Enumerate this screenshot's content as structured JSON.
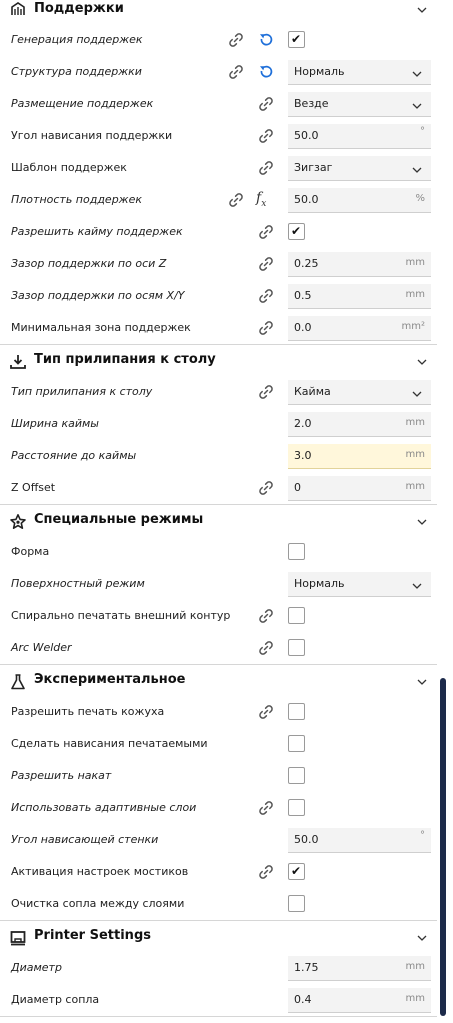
{
  "sections": [
    {
      "title": "Поддержки",
      "icon": "support-icon",
      "rows": [
        {
          "label": "Генерация поддержек",
          "italic": true,
          "link": "left",
          "reset": true,
          "control": "checkbox",
          "checked": true
        },
        {
          "label": "Структура поддержки",
          "italic": true,
          "link": "left",
          "reset": true,
          "control": "select",
          "value": "Нормаль"
        },
        {
          "label": "Размещение поддержек",
          "italic": true,
          "link": "right",
          "control": "select",
          "value": "Везде"
        },
        {
          "label": "Угол нависания поддержки",
          "italic": false,
          "link": "right",
          "control": "field",
          "value": "50.0",
          "unit": "°"
        },
        {
          "label": "Шаблон поддержек",
          "italic": false,
          "link": "right",
          "control": "select",
          "value": "Зигзаг"
        },
        {
          "label": "Плотность поддержек",
          "italic": true,
          "link": "left",
          "fx": true,
          "control": "field",
          "value": "50.0",
          "unit": "%"
        },
        {
          "label": "Разрешить кайму поддержек",
          "italic": true,
          "link": "right",
          "control": "checkbox",
          "checked": true
        },
        {
          "label": "Зазор поддержки по оси Z",
          "italic": true,
          "link": "right",
          "control": "field",
          "value": "0.25",
          "unit": "mm"
        },
        {
          "label": "Зазор поддержки по осям X/Y",
          "italic": true,
          "link": "right",
          "control": "field",
          "value": "0.5",
          "unit": "mm"
        },
        {
          "label": "Минимальная зона поддержек",
          "italic": false,
          "link": "right",
          "control": "field",
          "value": "0.0",
          "unit": "mm²"
        }
      ]
    },
    {
      "title": "Тип прилипания к столу",
      "icon": "bed-adhesion-icon",
      "rows": [
        {
          "label": "Тип прилипания к столу",
          "italic": true,
          "link": "right",
          "control": "select",
          "value": "Кайма"
        },
        {
          "label": "Ширина каймы",
          "italic": true,
          "control": "field",
          "value": "2.0",
          "unit": "mm"
        },
        {
          "label": "Расстояние до каймы",
          "italic": true,
          "control": "field",
          "value": "3.0",
          "unit": "mm",
          "highlight": true
        },
        {
          "label": "Z Offset",
          "italic": false,
          "link": "right",
          "control": "field",
          "value": "0",
          "unit": "mm"
        }
      ]
    },
    {
      "title": "Специальные режимы",
      "icon": "star-icon",
      "rows": [
        {
          "label": "Форма",
          "italic": false,
          "control": "checkbox",
          "checked": false
        },
        {
          "label": "Поверхностный режим",
          "italic": true,
          "control": "select",
          "value": "Нормаль"
        },
        {
          "label": "Спирально печатать внешний контур",
          "italic": false,
          "link": "right",
          "control": "checkbox",
          "checked": false
        },
        {
          "label": "Arc Welder",
          "italic": true,
          "link": "right",
          "control": "checkbox",
          "checked": false
        }
      ]
    },
    {
      "title": "Экспериментальное",
      "icon": "flask-icon",
      "rows": [
        {
          "label": "Разрешить печать кожуха",
          "italic": false,
          "link": "right",
          "control": "checkbox",
          "checked": false
        },
        {
          "label": "Сделать нависания печатаемыми",
          "italic": false,
          "control": "checkbox",
          "checked": false
        },
        {
          "label": "Разрешить накат",
          "italic": true,
          "control": "checkbox",
          "checked": false
        },
        {
          "label": "Использовать адаптивные слои",
          "italic": true,
          "link": "right",
          "control": "checkbox",
          "checked": false
        },
        {
          "label": "Угол нависающей стенки",
          "italic": true,
          "control": "field",
          "value": "50.0",
          "unit": "°"
        },
        {
          "label": "Активация настроек мостиков",
          "italic": false,
          "link": "right",
          "control": "checkbox",
          "checked": true
        },
        {
          "label": "Очистка сопла между слоями",
          "italic": false,
          "control": "checkbox",
          "checked": false
        }
      ]
    },
    {
      "title": "Printer Settings",
      "icon": "printer-icon",
      "rows": [
        {
          "label": "Диаметр",
          "italic": true,
          "control": "field",
          "value": "1.75",
          "unit": "mm"
        },
        {
          "label": "Диаметр сопла",
          "italic": false,
          "control": "field",
          "value": "0.4",
          "unit": "mm"
        }
      ]
    }
  ],
  "colors": {
    "accent": "#1e6fd9",
    "scrollbar": "#1c2a4a",
    "highlight": "#fff7db"
  },
  "glyphs": {
    "check": "✔",
    "fx": "f",
    "fx_sub": "x"
  }
}
